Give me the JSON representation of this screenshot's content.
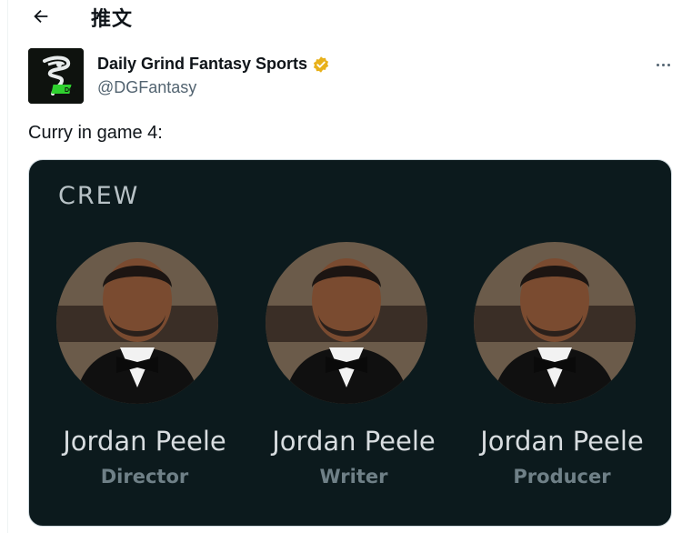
{
  "header": {
    "title": "推文"
  },
  "author": {
    "name": "Daily Grind Fantasy Sports",
    "handle": "@DGFantasy",
    "avatar_text": "DGF"
  },
  "tweet": {
    "text": "Curry in game 4:"
  },
  "media": {
    "section_label": "CREW",
    "people": [
      {
        "name": "Jordan Peele",
        "role": "Director"
      },
      {
        "name": "Jordan Peele",
        "role": "Writer"
      },
      {
        "name": "Jordan Peele",
        "role": "Producer"
      }
    ]
  },
  "colors": {
    "verified": "#e8b11b",
    "media_bg": "#0c1a1d",
    "logo_green": "#2fd12f"
  }
}
